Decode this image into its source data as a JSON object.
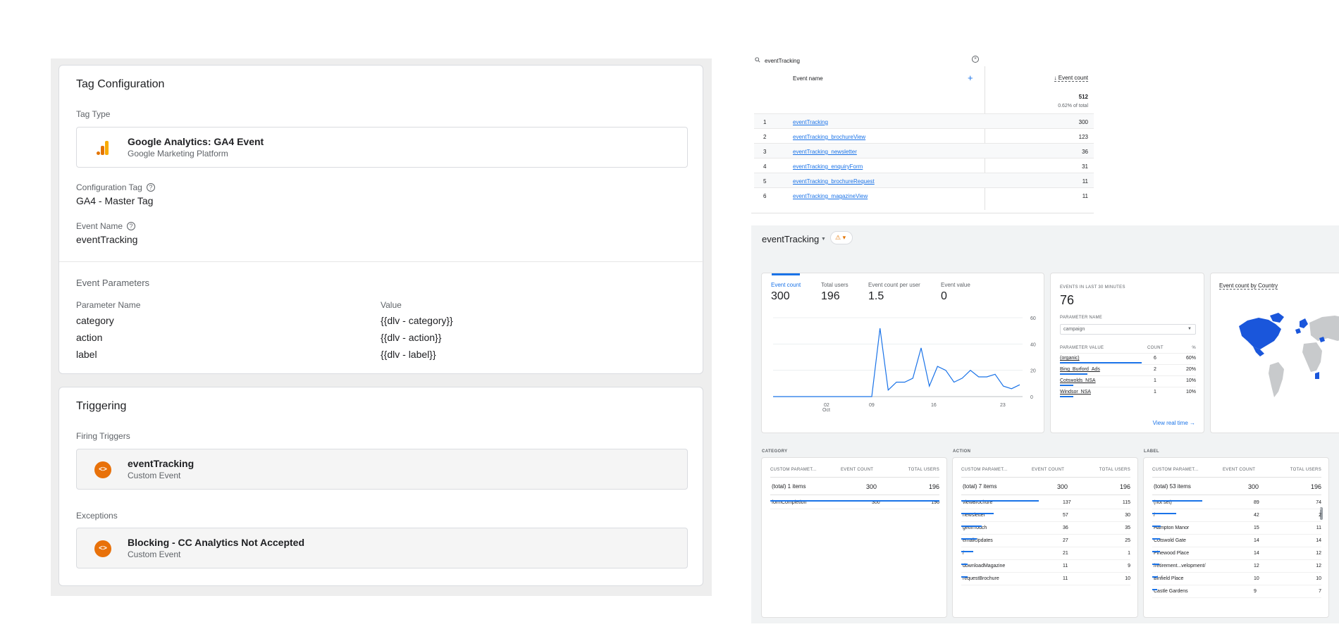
{
  "gtm": {
    "tag_config": {
      "title": "Tag Configuration",
      "tag_type_label": "Tag Type",
      "tag_type_name": "Google Analytics: GA4 Event",
      "tag_type_vendor": "Google Marketing Platform",
      "config_tag_label": "Configuration Tag",
      "config_tag_value": "GA4 - Master Tag",
      "event_name_label": "Event Name",
      "event_name_value": "eventTracking",
      "event_params_title": "Event Parameters",
      "param_name_header": "Parameter Name",
      "value_header": "Value",
      "params": [
        {
          "name": "category",
          "value": "{{dlv - category}}"
        },
        {
          "name": "action",
          "value": "{{dlv - action}}"
        },
        {
          "name": "label",
          "value": "{{dlv - label}}"
        }
      ]
    },
    "triggering": {
      "title": "Triggering",
      "firing_label": "Firing Triggers",
      "firing_name": "eventTracking",
      "firing_type": "Custom Event",
      "exceptions_label": "Exceptions",
      "exception_name": "Blocking - CC Analytics Not Accepted",
      "exception_type": "Custom Event"
    },
    "icons": {
      "ga4": "analytics-bars-icon",
      "trigger": "custom-event-icon"
    },
    "colors": {
      "ga_orange": "#f9ab00",
      "trigger_orange": "#e8710a"
    }
  },
  "event_table": {
    "search_value": "eventTracking",
    "col_name": "Event name",
    "col_count": "Event count",
    "total": "512",
    "total_pct": "0.62% of total",
    "rows": [
      {
        "idx": "1",
        "name": "eventTracking",
        "count": "300"
      },
      {
        "idx": "2",
        "name": "eventTracking_brochureView",
        "count": "123"
      },
      {
        "idx": "3",
        "name": "eventTracking_newsletter",
        "count": "36"
      },
      {
        "idx": "4",
        "name": "eventTracking_enquiryForm",
        "count": "31"
      },
      {
        "idx": "5",
        "name": "eventTracking_brochureRequest",
        "count": "11"
      },
      {
        "idx": "6",
        "name": "eventTracking_magazineView",
        "count": "11"
      }
    ]
  },
  "realtime": {
    "title": "eventTracking",
    "metrics": [
      {
        "label": "Event count",
        "value": "300"
      },
      {
        "label": "Total users",
        "value": "196"
      },
      {
        "label": "Event count per user",
        "value": "1.5"
      },
      {
        "label": "Event value",
        "value": "0"
      }
    ],
    "events_card": {
      "heading": "EVENTS IN LAST 30 MINUTES",
      "value": "76",
      "param_name_label": "PARAMETER NAME",
      "param_select": "campaign",
      "col_value": "PARAMETER VALUE",
      "col_count": "COUNT",
      "col_pct": "%",
      "rows": [
        {
          "name": "(organic)",
          "count": "6",
          "pct": "60%",
          "share": 0.6
        },
        {
          "name": "Bing_Burford_Ads",
          "count": "2",
          "pct": "20%",
          "share": 0.2
        },
        {
          "name": "Cotswolds_NSA",
          "count": "1",
          "pct": "10%",
          "share": 0.1
        },
        {
          "name": "Windsor_NSA",
          "count": "1",
          "pct": "10%",
          "share": 0.1
        }
      ],
      "view_link": "View real time"
    },
    "map_title": "Event count by Country",
    "dimensions": [
      {
        "section": "CATEGORY",
        "col1": "CUSTOM PARAMET...",
        "col2": "EVENT COUNT",
        "col3": "TOTAL USERS",
        "total_label": "(total) 1 items",
        "total_count": "300",
        "total_users": "196",
        "rows": [
          {
            "name": "formCompletion",
            "count": "300",
            "users": "196",
            "share": 1.0
          }
        ]
      },
      {
        "section": "ACTION",
        "col1": "CUSTOM PARAMET...",
        "col2": "EVENT COUNT",
        "col3": "TOTAL USERS",
        "total_label": "(total) 7 items",
        "total_count": "300",
        "total_users": "196",
        "rows": [
          {
            "name": "viewBrochure",
            "count": "137",
            "users": "115",
            "share": 0.457
          },
          {
            "name": "newsletter",
            "count": "57",
            "users": "30",
            "share": 0.19
          },
          {
            "name": "getInTouch",
            "count": "36",
            "users": "35",
            "share": 0.12
          },
          {
            "name": "emailUpdates",
            "count": "27",
            "users": "25",
            "share": 0.09
          },
          {
            "name": "/",
            "count": "21",
            "users": "1",
            "share": 0.07
          },
          {
            "name": "downloadMagazine",
            "count": "11",
            "users": "9",
            "share": 0.037
          },
          {
            "name": "requestBrochure",
            "count": "11",
            "users": "10",
            "share": 0.037
          }
        ]
      },
      {
        "section": "LABEL",
        "col1": "CUSTOM PARAMET...",
        "col2": "EVENT COUNT",
        "col3": "TOTAL USERS",
        "total_label": "(total) 53 items",
        "total_count": "300",
        "total_users": "196",
        "rows": [
          {
            "name": "(not set)",
            "count": "89",
            "users": "74",
            "share": 0.297
          },
          {
            "name": "/",
            "count": "42",
            "users": "2",
            "share": 0.14
          },
          {
            "name": "Hampton Manor",
            "count": "15",
            "users": "11",
            "share": 0.05
          },
          {
            "name": "Cotswold Gate",
            "count": "14",
            "users": "14",
            "share": 0.047
          },
          {
            "name": "Pinewood Place",
            "count": "14",
            "users": "12",
            "share": 0.047
          },
          {
            "name": "/retirement...velopment/",
            "count": "12",
            "users": "12",
            "share": 0.04
          },
          {
            "name": "Binfield Place",
            "count": "10",
            "users": "10",
            "share": 0.033
          },
          {
            "name": "Castle Gardens",
            "count": "9",
            "users": "7",
            "share": 0.03
          }
        ]
      }
    ]
  },
  "chart_data": {
    "type": "line",
    "x_tick_labels": [
      "02",
      "Oct",
      "09",
      "16",
      "23"
    ],
    "y_tick_labels": [
      "60",
      "40",
      "20",
      "0"
    ],
    "ylim": [
      0,
      60
    ],
    "x": [
      1,
      2,
      3,
      4,
      5,
      6,
      7,
      8,
      9,
      10,
      11,
      12,
      13,
      14,
      15,
      16,
      17,
      18,
      19,
      20,
      21,
      22,
      23,
      24,
      25,
      26,
      27,
      28,
      29,
      30
    ],
    "values": [
      0,
      0,
      0,
      0,
      0,
      0,
      0,
      0,
      0,
      0,
      0,
      0,
      0,
      52,
      5,
      11,
      11,
      14,
      37,
      8,
      23,
      20,
      11,
      14,
      20,
      15,
      15,
      17,
      8,
      6,
      9
    ],
    "color": "#1a73e8",
    "grid": true
  }
}
